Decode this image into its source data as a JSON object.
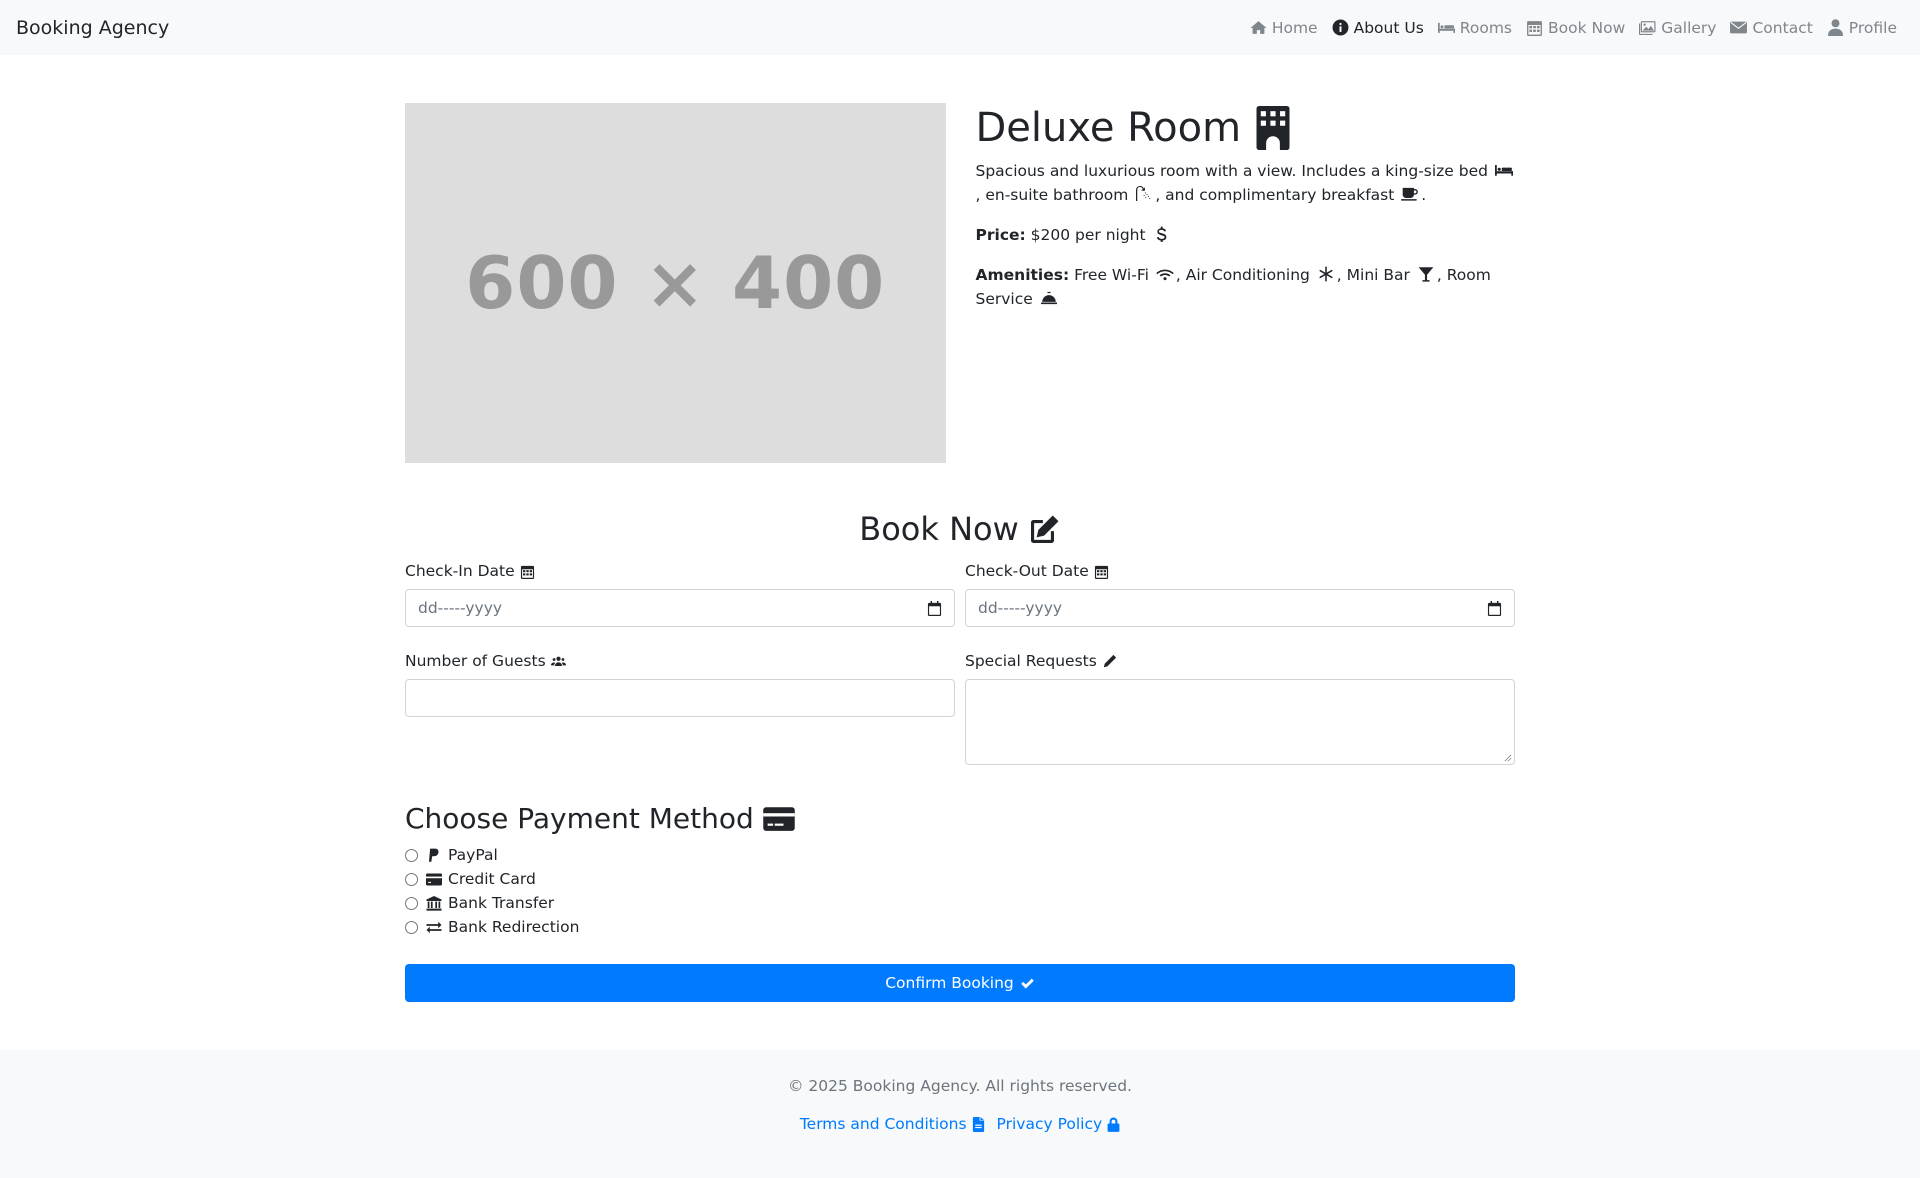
{
  "navbar": {
    "brand": "Booking Agency",
    "items": [
      {
        "label": "Home",
        "icon": "home-icon",
        "active": false
      },
      {
        "label": "About Us",
        "icon": "info-circle-icon",
        "active": true
      },
      {
        "label": "Rooms",
        "icon": "bed-icon",
        "active": false
      },
      {
        "label": "Book Now",
        "icon": "calendar-icon",
        "active": false
      },
      {
        "label": "Gallery",
        "icon": "images-icon",
        "active": false
      },
      {
        "label": "Contact",
        "icon": "envelope-icon",
        "active": false
      },
      {
        "label": "Profile",
        "icon": "user-icon",
        "active": false
      }
    ]
  },
  "room": {
    "image_placeholder": "600 × 400",
    "title": "Deluxe Room",
    "description_part1": "Spacious and luxurious room with a view. Includes a king-size bed",
    "description_part2": ", en-suite bathroom",
    "description_part3": ", and complimentary breakfast",
    "description_part4": ".",
    "price_label": "Price:",
    "price_value": "$200 per night",
    "amenities_label": "Amenities:",
    "amenity_1": "Free Wi-Fi",
    "amenity_2": ", Air Conditioning",
    "amenity_3": ", Mini Bar",
    "amenity_4": ", Room Service"
  },
  "booking": {
    "title": "Book Now",
    "checkin_label": "Check-In Date",
    "checkin_placeholder": "dd-----yyyy",
    "checkout_label": "Check-Out Date",
    "checkout_placeholder": "dd-----yyyy",
    "guests_label": "Number of Guests",
    "guests_value": "",
    "requests_label": "Special Requests",
    "requests_value": ""
  },
  "payment": {
    "title": "Choose Payment Method",
    "options": [
      {
        "label": "PayPal",
        "icon": "paypal-icon"
      },
      {
        "label": "Credit Card",
        "icon": "credit-card-icon"
      },
      {
        "label": "Bank Transfer",
        "icon": "bank-icon"
      },
      {
        "label": "Bank Redirection",
        "icon": "exchange-icon"
      }
    ],
    "confirm_label": "Confirm Booking"
  },
  "footer": {
    "copyright": "© 2025 Booking Agency. All rights reserved.",
    "terms": "Terms and Conditions",
    "privacy": "Privacy Policy"
  },
  "colors": {
    "primary": "#007bff",
    "navbar_bg": "#f8f9fa",
    "placeholder_bg": "#dddddd"
  }
}
